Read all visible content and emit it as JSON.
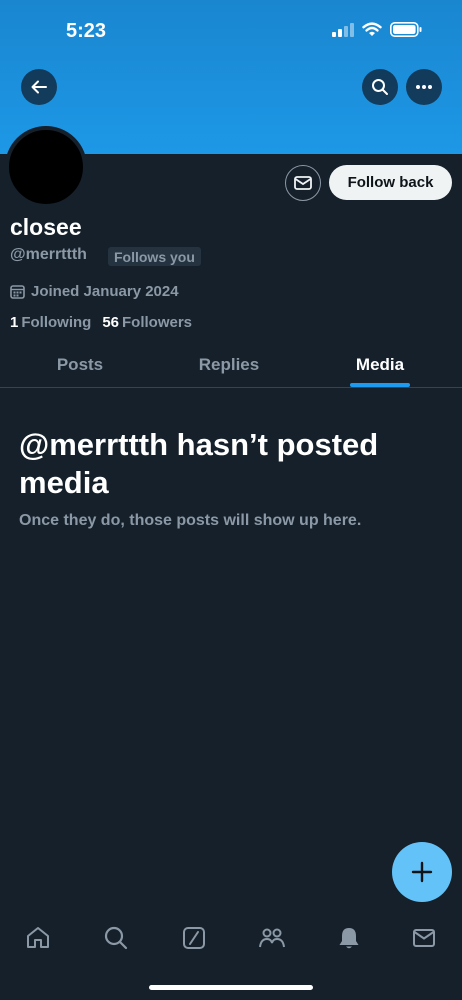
{
  "status_bar": {
    "time": "5:23",
    "icons": [
      "signal-icon",
      "wifi-icon",
      "battery-icon"
    ]
  },
  "header": {
    "back_icon": "arrow-left-icon",
    "search_icon": "search-icon",
    "more_icon": "more-horizontal-icon",
    "banner_color": "#1d98e6"
  },
  "profile": {
    "display_name": "closee",
    "handle": "@merrttth",
    "follows_you_badge": "Follows you",
    "joined": "Joined January 2024",
    "following_count": "1",
    "following_label": "Following",
    "followers_count": "56",
    "followers_label": "Followers",
    "message_icon": "envelope-icon",
    "follow_button_label": "Follow back"
  },
  "tabs": [
    {
      "label": "Posts",
      "active": false
    },
    {
      "label": "Replies",
      "active": false
    },
    {
      "label": "Media",
      "active": true
    }
  ],
  "empty_state": {
    "title": "@merrttth hasn’t posted media",
    "subtitle": "Once they do, those posts will show up here."
  },
  "fab": {
    "icon": "plus-icon",
    "color": "#63c2f7"
  },
  "bottom_nav": [
    {
      "name": "home-icon"
    },
    {
      "name": "search-icon"
    },
    {
      "name": "grok-icon"
    },
    {
      "name": "communities-icon"
    },
    {
      "name": "notifications-icon"
    },
    {
      "name": "messages-icon"
    }
  ],
  "colors": {
    "background": "#15202b",
    "accent": "#1d9bf0",
    "secondary_text": "#8b98a5"
  }
}
